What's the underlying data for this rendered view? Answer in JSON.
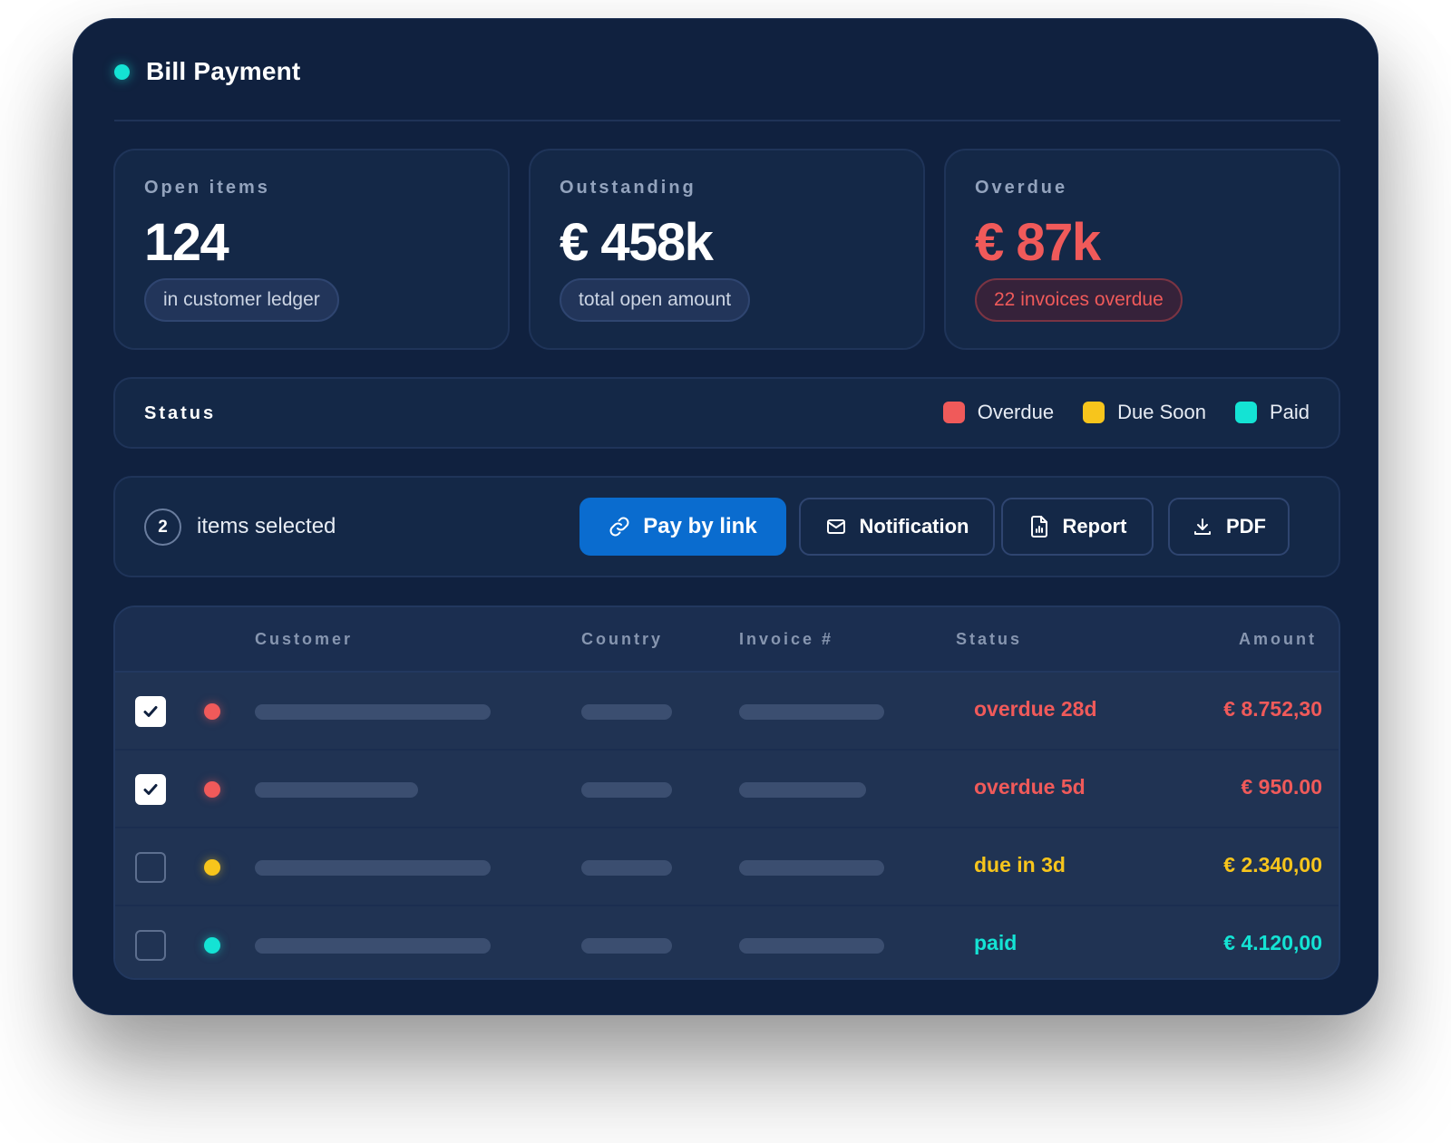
{
  "app": {
    "title": "Bill Payment"
  },
  "stats": [
    {
      "label": "Open items",
      "value": "124",
      "pill": "in customer ledger"
    },
    {
      "label": "Outstanding",
      "value": "€ 458k",
      "pill": "total open amount"
    },
    {
      "label": "Overdue",
      "value": "€ 87k",
      "pill": "22 invoices overdue"
    }
  ],
  "status_legend": {
    "title": "Status",
    "items": [
      {
        "label": "Overdue",
        "color": "#f05a5a"
      },
      {
        "label": "Due Soon",
        "color": "#f7c51c"
      },
      {
        "label": "Paid",
        "color": "#14e3d4"
      }
    ]
  },
  "selection": {
    "count": "2",
    "text": "items selected"
  },
  "actions": {
    "pay_by_link": "Pay by link",
    "notification": "Notification",
    "report": "Report",
    "pdf": "PDF"
  },
  "table": {
    "columns": {
      "customer": "Customer",
      "country": "Country",
      "invoice": "Invoice #",
      "status": "Status",
      "amount": "Amount"
    },
    "rows": [
      {
        "checked": true,
        "status": "overdue 28d",
        "amount": "€ 8.752,30",
        "color": "#f05a5a"
      },
      {
        "checked": true,
        "status": "overdue 5d",
        "amount": "€ 950.00",
        "color": "#f05a5a"
      },
      {
        "checked": false,
        "status": "due in 3d",
        "amount": "€ 2.340,00",
        "color": "#f7c51c"
      },
      {
        "checked": false,
        "status": "paid",
        "amount": "€ 4.120,00",
        "color": "#14e3d4"
      }
    ]
  },
  "colors": {
    "accent": "#0a6ccf",
    "overdue": "#f05a5a",
    "due_soon": "#f7c51c",
    "paid": "#14e3d4",
    "background": "#10213f"
  }
}
